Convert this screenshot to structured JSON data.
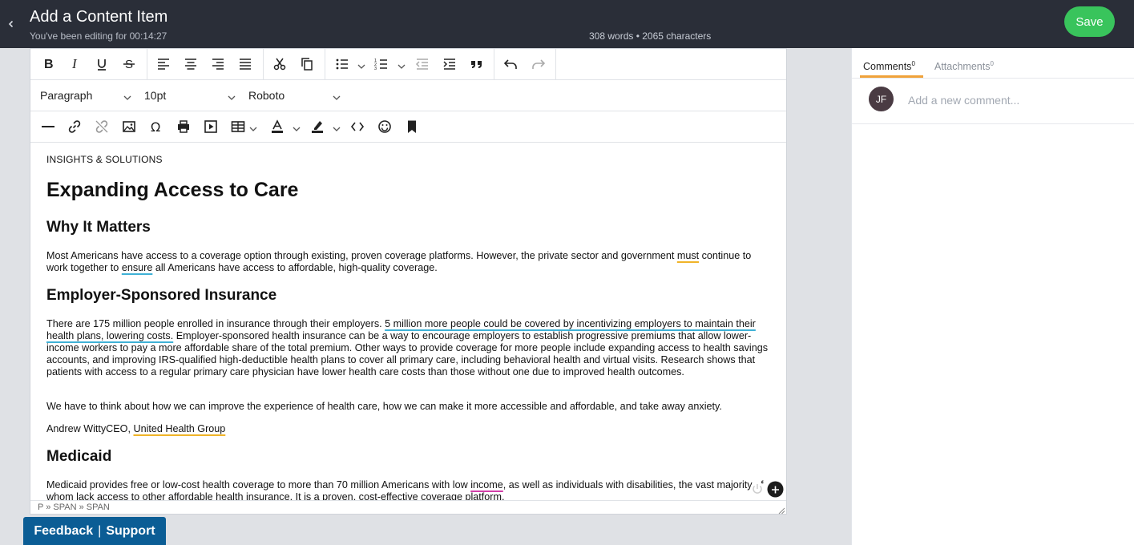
{
  "header": {
    "back_icon": "chevron-left-icon",
    "title": "Add a Content Item",
    "subtitle": "You've been editing for 00:14:27",
    "word_count": "308 words • 2065 characters",
    "save_label": "Save"
  },
  "toolbar": {
    "block_format": "Paragraph",
    "font_size": "10pt",
    "font_family": "Roboto"
  },
  "document": {
    "kicker": "INSIGHTS & SOLUTIONS",
    "title": "Expanding Access to Care",
    "why_heading": "Why It Matters",
    "why_p_a": "Most Americans have access to a coverage option through existing, proven coverage platforms. However, the private sector and government ",
    "why_p_must": "must",
    "why_p_b": " continue to work together to ",
    "why_p_ensure": "ensure",
    "why_p_c": " all Americans have access to affordable, high-quality coverage.",
    "esi_heading": "Employer-Sponsored Insurance",
    "esi_p_a": "There are 175 million people enrolled in insurance through their employers. ",
    "esi_p_link": "5 million more people could be covered by incentivizing employers to maintain their health plans, lowering costs.",
    "esi_p_b": " Employer-sponsored health insurance can be a way to encourage employers to establish progressive premiums that allow lower-income workers to pay a more affordable share of the total premium. Other ways to provide coverage for more people include expanding access to health savings accounts, and improving IRS-qualified high-deductible health plans to cover all primary care, including behavioral health and virtual visits. Research shows that patients with access to a regular primary care physician have lower health care costs than those without one due to improved health outcomes.",
    "quote": "We have to think about how we can improve the experience of health care, how we can make it more accessible and affordable, and take away anxiety.",
    "attrib_a": "Andrew WittyCEO, ",
    "attrib_org": "United Health Group",
    "medicaid_heading": "Medicaid",
    "medicaid_p_a": "Medicaid provides free or low-cost health coverage to more than 70 million Americans with low ",
    "medicaid_p_income": "income",
    "medicaid_p_b": ", as well as individuals with disabilities, the vast majority of whom lack access to other affordable health insurance. It is a proven, cost-effective coverage platform."
  },
  "statusbar": {
    "path": "P » SPAN » SPAN"
  },
  "panel": {
    "tab_comments": "Comments",
    "tab_comments_count": "0",
    "tab_attachments": "Attachments",
    "tab_attachments_count": "0",
    "avatar_initials": "JF",
    "comment_placeholder": "Add a new comment..."
  },
  "footer": {
    "feedback": "Feedback",
    "separator": "|",
    "support": "Support"
  },
  "colors": {
    "header_bg": "#2a2e38",
    "save_green": "#39c45c",
    "tab_accent": "#f0a23a",
    "feedback_blue": "#0b5d95"
  }
}
